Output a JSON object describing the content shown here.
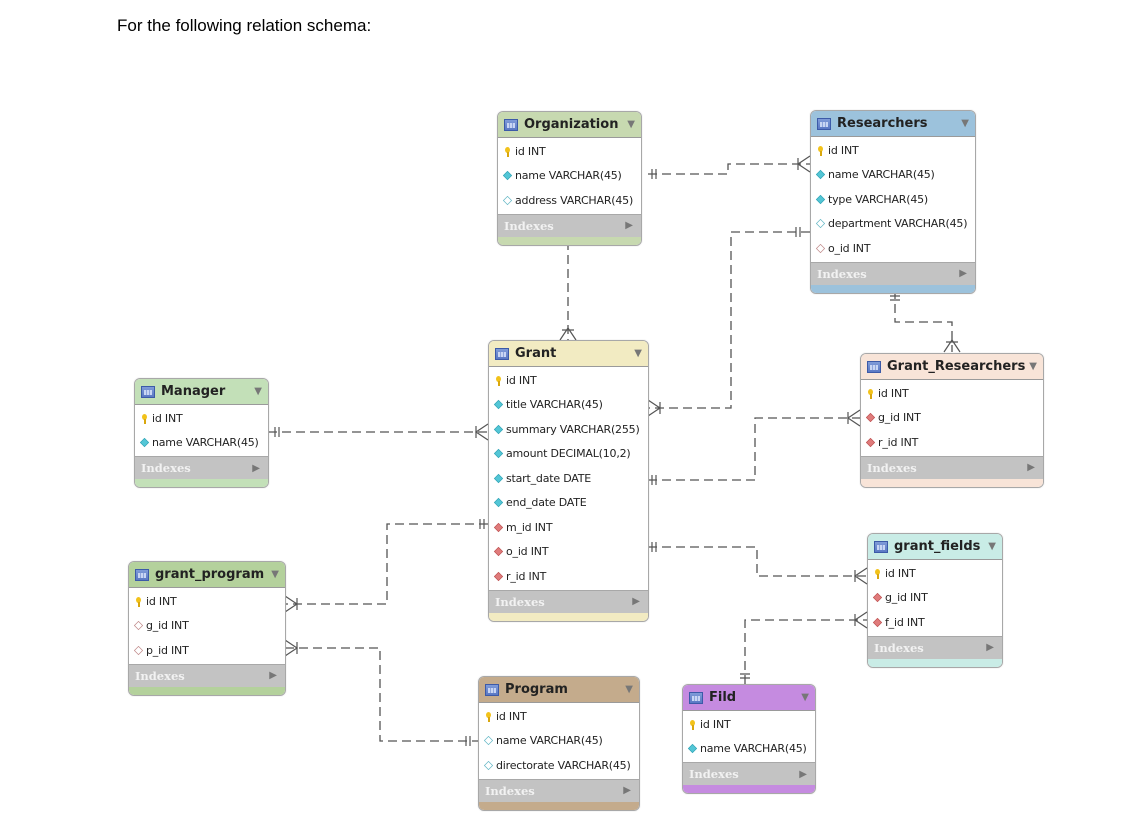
{
  "intro_text": "For the following relation schema:",
  "indexes_label": "Indexes",
  "tables": {
    "organization": {
      "name": "Organization",
      "color": "#c7d9b0",
      "columns": [
        {
          "name": "id INT",
          "key": "pk"
        },
        {
          "name": "name VARCHAR(45)",
          "key": "nn"
        },
        {
          "name": "address VARCHAR(45)",
          "key": "nul"
        }
      ]
    },
    "researchers": {
      "name": "Researchers",
      "color": "#9cc2dc",
      "columns": [
        {
          "name": "id INT",
          "key": "pk"
        },
        {
          "name": "name VARCHAR(45)",
          "key": "nn"
        },
        {
          "name": "type VARCHAR(45)",
          "key": "nn"
        },
        {
          "name": "department VARCHAR(45)",
          "key": "nul"
        },
        {
          "name": "o_id INT",
          "key": "fknul"
        }
      ]
    },
    "grant": {
      "name": "Grant",
      "color": "#f2ebc2",
      "columns": [
        {
          "name": "id INT",
          "key": "pk"
        },
        {
          "name": "title VARCHAR(45)",
          "key": "nn"
        },
        {
          "name": "summary VARCHAR(255)",
          "key": "nn"
        },
        {
          "name": "amount DECIMAL(10,2)",
          "key": "nn"
        },
        {
          "name": "start_date DATE",
          "key": "nn"
        },
        {
          "name": "end_date DATE",
          "key": "nn"
        },
        {
          "name": "m_id INT",
          "key": "fk"
        },
        {
          "name": "o_id INT",
          "key": "fk"
        },
        {
          "name": "r_id INT",
          "key": "fk"
        }
      ]
    },
    "manager": {
      "name": "Manager",
      "color": "#c3e0b8",
      "columns": [
        {
          "name": "id INT",
          "key": "pk"
        },
        {
          "name": "name VARCHAR(45)",
          "key": "nn"
        }
      ]
    },
    "grant_researchers": {
      "name": "Grant_Researchers",
      "color": "#f8e4d8",
      "columns": [
        {
          "name": "id INT",
          "key": "pk"
        },
        {
          "name": "g_id INT",
          "key": "fk"
        },
        {
          "name": "r_id INT",
          "key": "fk"
        }
      ]
    },
    "grant_program": {
      "name": "grant_program",
      "color": "#b4d19c",
      "columns": [
        {
          "name": "id INT",
          "key": "pk"
        },
        {
          "name": "g_id INT",
          "key": "fknul"
        },
        {
          "name": "p_id INT",
          "key": "fknul"
        }
      ]
    },
    "grant_fields": {
      "name": "grant_fields",
      "color": "#c9ece6",
      "columns": [
        {
          "name": "id INT",
          "key": "pk"
        },
        {
          "name": "g_id INT",
          "key": "fk"
        },
        {
          "name": "f_id INT",
          "key": "fk"
        }
      ]
    },
    "program": {
      "name": "Program",
      "color": "#c4ab8c",
      "columns": [
        {
          "name": "id INT",
          "key": "pk"
        },
        {
          "name": "name VARCHAR(45)",
          "key": "nul"
        },
        {
          "name": "directorate VARCHAR(45)",
          "key": "nul"
        }
      ]
    },
    "fild": {
      "name": "Fild",
      "color": "#c58be0",
      "columns": [
        {
          "name": "id INT",
          "key": "pk"
        },
        {
          "name": "name VARCHAR(45)",
          "key": "nn"
        }
      ]
    }
  },
  "relationships": [
    {
      "from": "organization",
      "to": "researchers",
      "from_card": "one",
      "to_card": "many"
    },
    {
      "from": "organization",
      "to": "grant",
      "from_card": "one",
      "to_card": "many"
    },
    {
      "from": "researchers",
      "to": "grant",
      "from_card": "one-mandatory",
      "to_card": "many"
    },
    {
      "from": "researchers",
      "to": "grant_researchers",
      "from_card": "one-mandatory",
      "to_card": "many"
    },
    {
      "from": "grant",
      "to": "grant_researchers",
      "from_card": "one-mandatory",
      "to_card": "many"
    },
    {
      "from": "manager",
      "to": "grant",
      "from_card": "one-mandatory",
      "to_card": "many"
    },
    {
      "from": "grant",
      "to": "grant_program",
      "from_card": "one-mandatory",
      "to_card": "many"
    },
    {
      "from": "program",
      "to": "grant_program",
      "from_card": "one-mandatory",
      "to_card": "many"
    },
    {
      "from": "grant",
      "to": "grant_fields",
      "from_card": "one-mandatory",
      "to_card": "many"
    },
    {
      "from": "fild",
      "to": "grant_fields",
      "from_card": "one-mandatory",
      "to_card": "many"
    }
  ]
}
